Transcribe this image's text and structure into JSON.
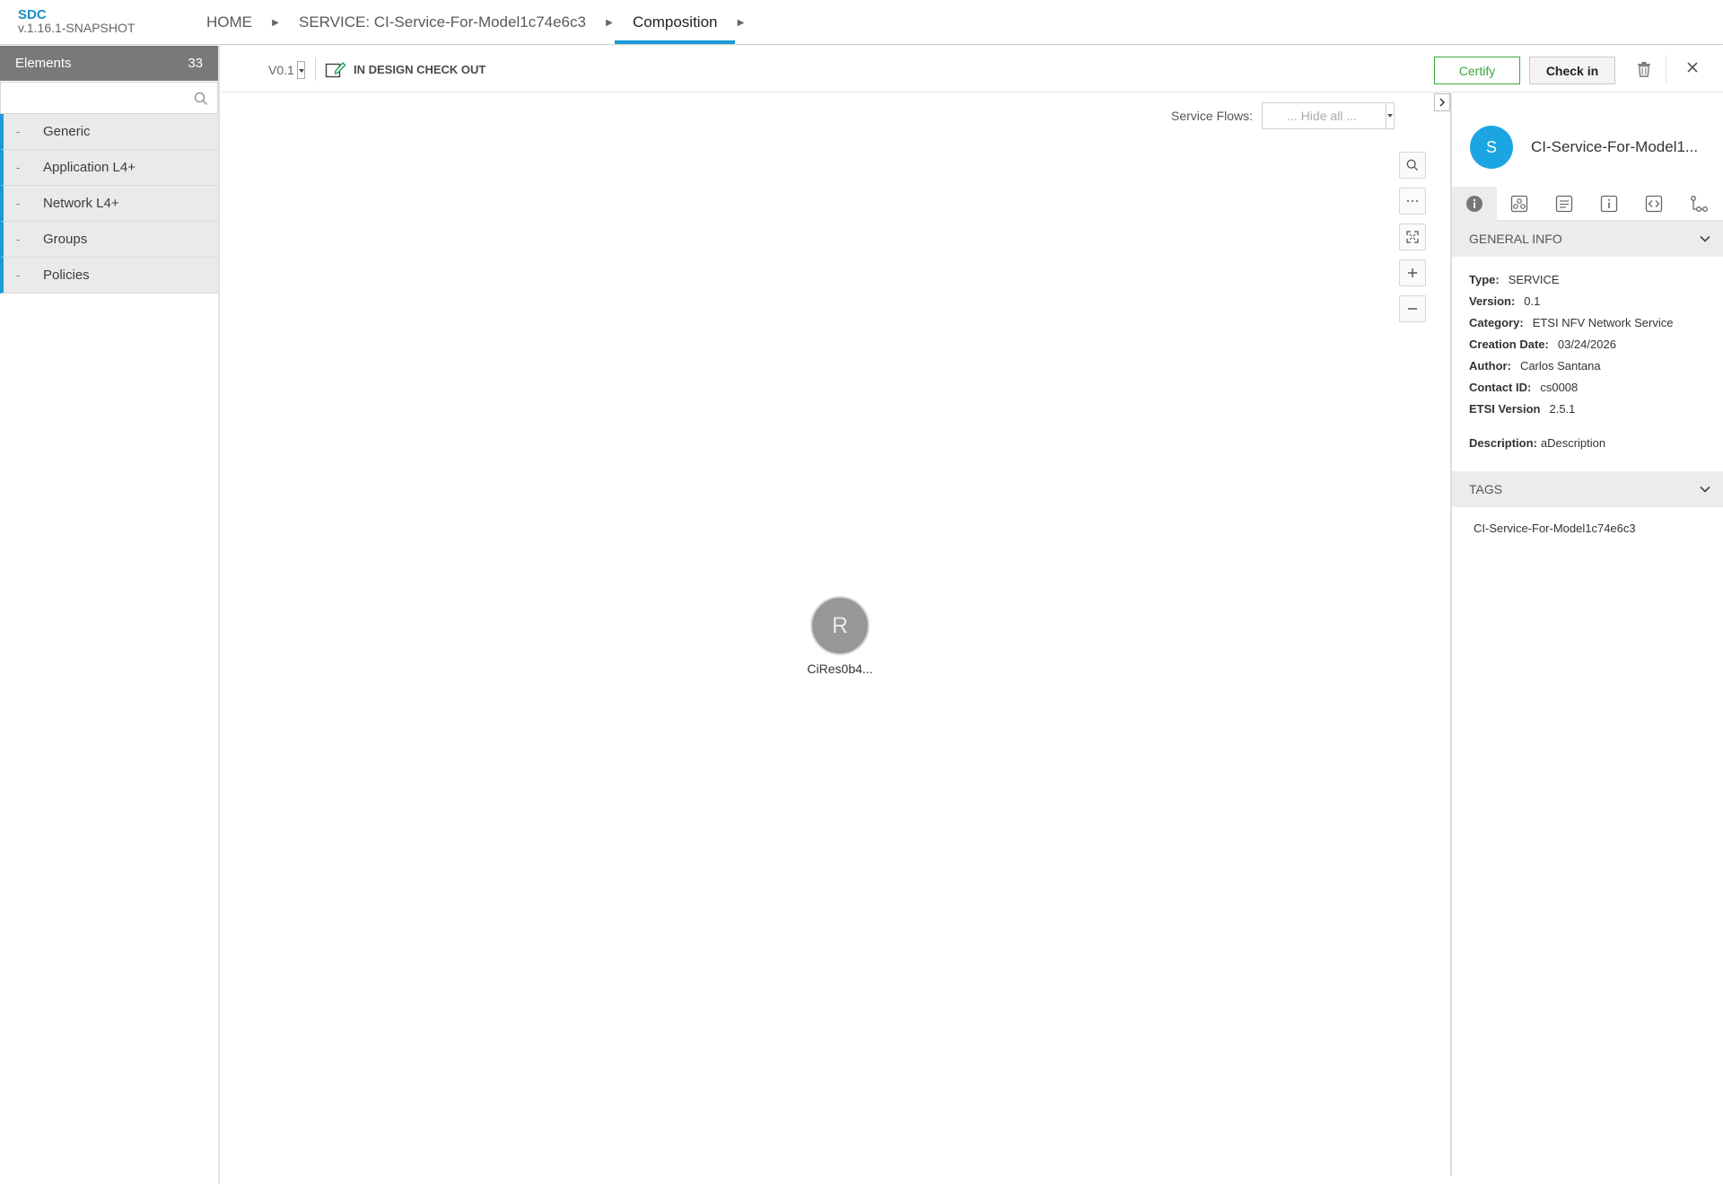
{
  "header": {
    "app_name": "SDC",
    "app_version": "v.1.16.1-SNAPSHOT",
    "breadcrumbs": [
      {
        "label": "HOME"
      },
      {
        "label": "SERVICE: CI-Service-For-Model1c74e6c3"
      },
      {
        "label": "Composition"
      }
    ]
  },
  "palette": {
    "title": "Elements",
    "count": "33",
    "search_placeholder": "",
    "items": [
      {
        "label": "Generic"
      },
      {
        "label": "Application L4+"
      },
      {
        "label": "Network L4+"
      },
      {
        "label": "Groups"
      },
      {
        "label": "Policies"
      }
    ]
  },
  "toolbar": {
    "version": "V0.1",
    "status": "IN DESIGN CHECK OUT",
    "certify_label": "Certify",
    "checkin_label": "Check in"
  },
  "canvas": {
    "service_flows_label": "Service Flows:",
    "service_flows_value": "... Hide all ...",
    "node": {
      "letter": "R",
      "label": "CiRes0b4..."
    }
  },
  "details": {
    "avatar_letter": "S",
    "title": "CI-Service-For-Model1...",
    "general_info_title": "GENERAL INFO",
    "fields": [
      {
        "key": "Type:",
        "value": "SERVICE"
      },
      {
        "key": "Version:",
        "value": "0.1"
      },
      {
        "key": "Category:",
        "value": "ETSI NFV Network Service"
      },
      {
        "key": "Creation Date:",
        "value": "03/24/2026"
      },
      {
        "key": "Author:",
        "value": "Carlos Santana"
      },
      {
        "key": "Contact ID:",
        "value": "cs0008"
      },
      {
        "key": "ETSI Version",
        "value": "2.5.1"
      }
    ],
    "description_key": "Description:",
    "description_value": "aDescription",
    "tags_title": "TAGS",
    "tags": [
      "CI-Service-For-Model1c74e6c3"
    ]
  },
  "colors": {
    "accent": "#1a9bd7",
    "certify_green": "#3aa93a",
    "palette_header": "#797979",
    "node_grey": "#979797",
    "avatar_blue": "#1ba6e3"
  }
}
